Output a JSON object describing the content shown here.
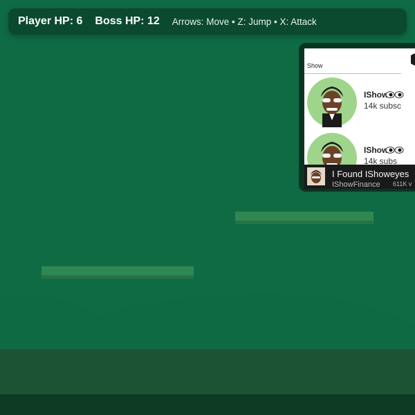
{
  "hud": {
    "player_hp": "Player HP: 6",
    "boss_hp": "Boss HP: 12",
    "controls": "Arrows: Move • Z: Jump • X: Attack"
  },
  "boss": {
    "search_label": "Show",
    "results": [
      {
        "name": "IShow",
        "subs": "14k subsc"
      },
      {
        "name": "IShow",
        "subs": "14k subs"
      }
    ],
    "video_title": "I Found IShoweyes",
    "channel": "IShowFinance",
    "views": "611K v"
  },
  "colors": {
    "sky": "#0f6b44",
    "hud_bg": "#0b4a2f",
    "platform": "#2f8752",
    "hill": "#0d6a42",
    "ground": "#1c5334",
    "bedrock": "#0c3a22"
  }
}
